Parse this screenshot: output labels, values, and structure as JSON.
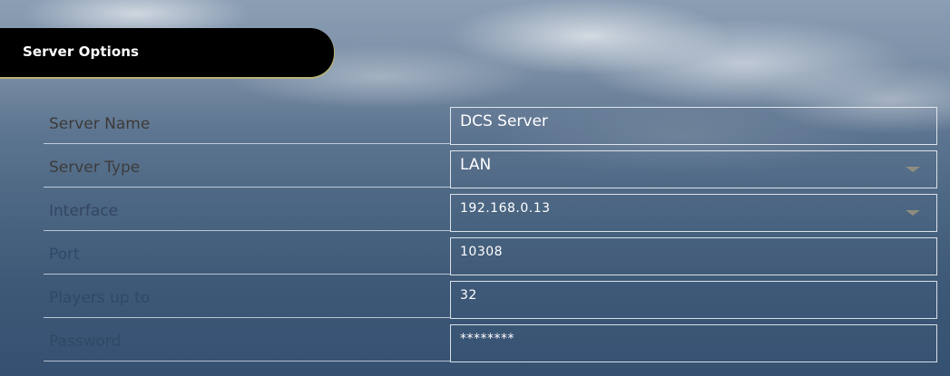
{
  "header": {
    "title": "Server Options"
  },
  "rows": [
    {
      "label": "Server Name",
      "value": "DCS Server"
    },
    {
      "label": "Server Type",
      "value": "LAN",
      "icon": "chevron-down-icon"
    },
    {
      "label": "Interface",
      "value": "192.168.0.13",
      "icon": "chevron-down-icon"
    },
    {
      "label": "Port",
      "value": "10308"
    },
    {
      "label": "Players up to",
      "value": "32"
    },
    {
      "label": "Password",
      "value": "********"
    }
  ]
}
